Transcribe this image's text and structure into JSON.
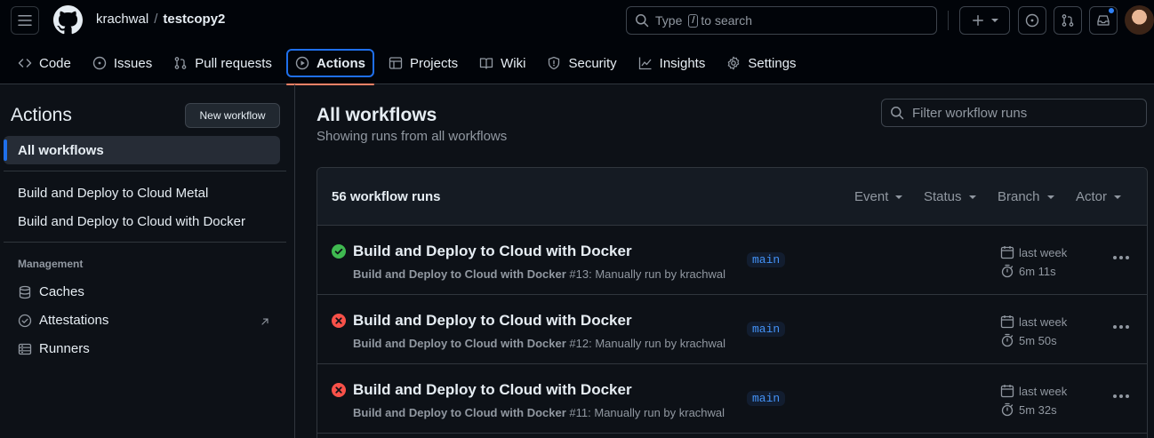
{
  "header": {
    "owner": "krachwal",
    "separator": "/",
    "repo": "testcopy2",
    "search": {
      "prefix": "Type",
      "key": "/",
      "suffix": "to search"
    }
  },
  "tabs": [
    {
      "label": "Code",
      "icon": "code-icon"
    },
    {
      "label": "Issues",
      "icon": "issue-opened-icon"
    },
    {
      "label": "Pull requests",
      "icon": "git-pull-request-icon"
    },
    {
      "label": "Actions",
      "icon": "play-icon",
      "active": true
    },
    {
      "label": "Projects",
      "icon": "table-icon"
    },
    {
      "label": "Wiki",
      "icon": "book-icon"
    },
    {
      "label": "Security",
      "icon": "shield-icon"
    },
    {
      "label": "Insights",
      "icon": "graph-icon"
    },
    {
      "label": "Settings",
      "icon": "gear-icon"
    }
  ],
  "sidebar": {
    "title": "Actions",
    "new_workflow": "New workflow",
    "all_workflows": "All workflows",
    "workflows": [
      "Build and Deploy to Cloud Metal",
      "Build and Deploy to Cloud with Docker"
    ],
    "management_heading": "Management",
    "management": [
      {
        "label": "Caches",
        "icon": "database-icon"
      },
      {
        "label": "Attestations",
        "icon": "verified-icon"
      },
      {
        "label": "Runners",
        "icon": "server-icon"
      }
    ]
  },
  "main": {
    "title": "All workflows",
    "subtitle": "Showing runs from all workflows",
    "filter_placeholder": "Filter workflow runs",
    "runs_count": "56 workflow runs",
    "filters": [
      "Event",
      "Status",
      "Branch",
      "Actor"
    ],
    "runs": [
      {
        "status": "success",
        "title": "Build and Deploy to Cloud with Docker",
        "workflow": "Build and Deploy to Cloud with Docker",
        "detail": "#13: Manually run by krachwal",
        "branch": "main",
        "when": "last week",
        "duration": "6m 11s"
      },
      {
        "status": "failure",
        "title": "Build and Deploy to Cloud with Docker",
        "workflow": "Build and Deploy to Cloud with Docker",
        "detail": "#12: Manually run by krachwal",
        "branch": "main",
        "when": "last week",
        "duration": "5m 50s"
      },
      {
        "status": "failure",
        "title": "Build and Deploy to Cloud with Docker",
        "workflow": "Build and Deploy to Cloud with Docker",
        "detail": "#11: Manually run by krachwal",
        "branch": "main",
        "when": "last week",
        "duration": "5m 32s"
      }
    ]
  },
  "colors": {
    "success": "#3fb950",
    "failure": "#f85149",
    "accent": "#1f6feb",
    "underline": "#f78166"
  }
}
